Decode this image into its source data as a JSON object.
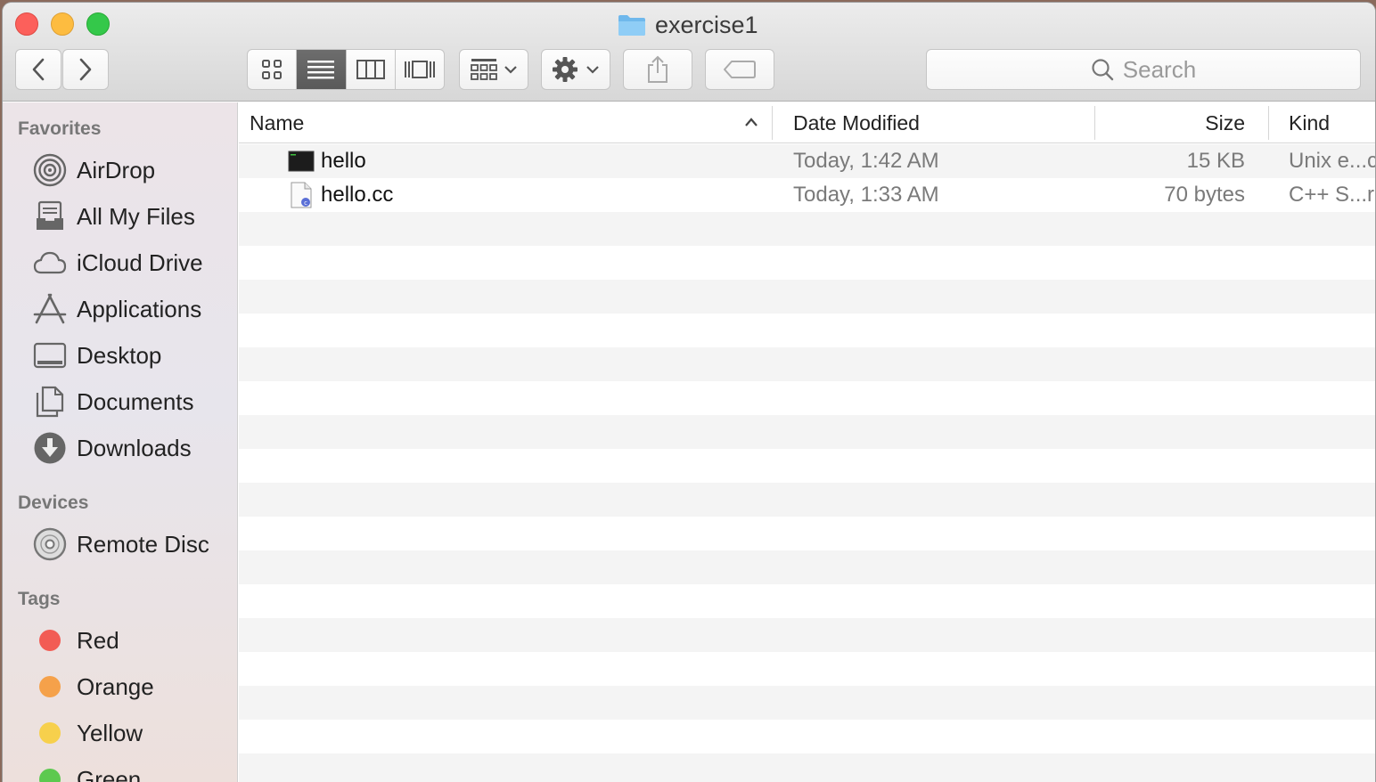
{
  "window": {
    "title": "exercise1"
  },
  "toolbar": {
    "search_placeholder": "Search"
  },
  "sidebar": {
    "favorites_header": "Favorites",
    "favorites": [
      {
        "label": "AirDrop",
        "icon": "airdrop-icon"
      },
      {
        "label": "All My Files",
        "icon": "all-my-files-icon"
      },
      {
        "label": "iCloud Drive",
        "icon": "icloud-icon"
      },
      {
        "label": "Applications",
        "icon": "applications-icon"
      },
      {
        "label": "Desktop",
        "icon": "desktop-icon"
      },
      {
        "label": "Documents",
        "icon": "documents-icon"
      },
      {
        "label": "Downloads",
        "icon": "downloads-icon"
      }
    ],
    "devices_header": "Devices",
    "devices": [
      {
        "label": "Remote Disc",
        "icon": "disc-icon"
      }
    ],
    "tags_header": "Tags",
    "tags": [
      {
        "label": "Red",
        "color": "#f25c54"
      },
      {
        "label": "Orange",
        "color": "#f5a14a"
      },
      {
        "label": "Yellow",
        "color": "#f7d04c"
      },
      {
        "label": "Green",
        "color": "#5dc94f"
      }
    ]
  },
  "columns": {
    "name": "Name",
    "date": "Date Modified",
    "size": "Size",
    "kind": "Kind"
  },
  "files": [
    {
      "name": "hello",
      "date": "Today, 1:42 AM",
      "size": "15 KB",
      "kind": "Unix e...c",
      "icon": "unix-executable-icon"
    },
    {
      "name": "hello.cc",
      "date": "Today, 1:33 AM",
      "size": "70 bytes",
      "kind": "C++ S...r",
      "icon": "cpp-source-icon"
    }
  ]
}
